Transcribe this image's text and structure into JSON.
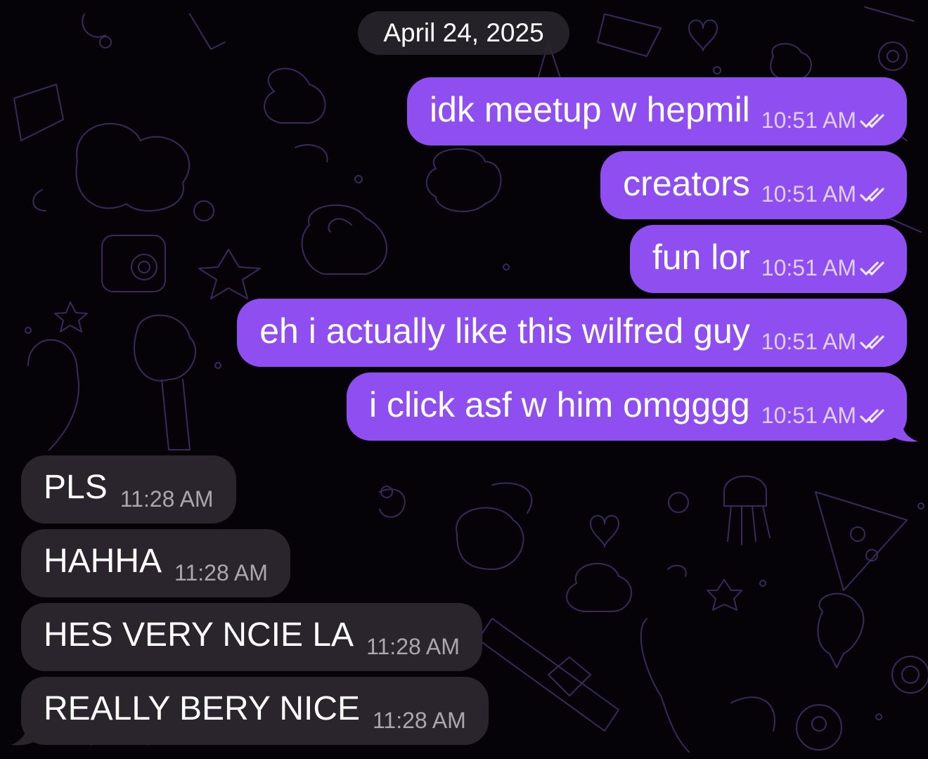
{
  "date_separator": "April 24, 2025",
  "colors": {
    "outgoing_bubble": "#8f4ff0",
    "incoming_bubble": "#2a252d",
    "background": "#050308"
  },
  "outgoing": [
    {
      "text": "idk meetup w hepmil",
      "time": "10:51 AM",
      "status_icon": "double-check-icon"
    },
    {
      "text": "creators",
      "time": "10:51 AM",
      "status_icon": "double-check-icon"
    },
    {
      "text": "fun lor",
      "time": "10:51 AM",
      "status_icon": "double-check-icon"
    },
    {
      "text": "eh i actually like this wilfred guy",
      "time": "10:51 AM",
      "status_icon": "double-check-icon"
    },
    {
      "text": "i click asf w him omgggg",
      "time": "10:51 AM",
      "status_icon": "double-check-icon"
    }
  ],
  "incoming": [
    {
      "text": "PLS",
      "time": "11:28 AM"
    },
    {
      "text": "HAHHA",
      "time": "11:28 AM"
    },
    {
      "text": "HES VERY NCIE LA",
      "time": "11:28 AM"
    },
    {
      "text": "REALLY BERY NICE",
      "time": "11:28 AM"
    }
  ]
}
